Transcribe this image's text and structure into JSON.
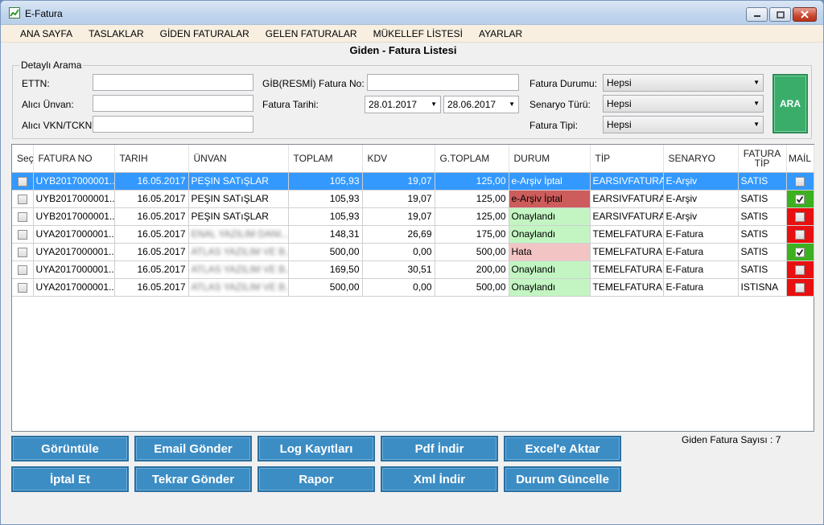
{
  "window": {
    "title": "E-Fatura"
  },
  "menu": [
    "ANA SAYFA",
    "TASLAKLAR",
    "GİDEN FATURALAR",
    "GELEN FATURALAR",
    "MÜKELLEF LİSTESİ",
    "AYARLAR"
  ],
  "page_title": "Giden - Fatura Listesi",
  "search": {
    "legend": "Detaylı Arama",
    "ettn_label": "ETTN:",
    "alici_unvan_label": "Alıcı Ünvan:",
    "alici_vkn_label": "Alıcı VKN/TCKN:",
    "gib_fatura_no_label": "GİB(RESMİ) Fatura No:",
    "fatura_tarihi_label": "Fatura Tarihi:",
    "date_from": "28.01.2017",
    "date_to": "28.06.2017",
    "fatura_durumu_label": "Fatura Durumu:",
    "fatura_durumu_value": "Hepsi",
    "senaryo_turu_label": "Senaryo Türü:",
    "senaryo_turu_value": "Hepsi",
    "fatura_tipi_label": "Fatura Tipi:",
    "fatura_tipi_value": "Hepsi",
    "ara_label": "ARA"
  },
  "table": {
    "headers": {
      "sec": "Seç",
      "fatura_no": "FATURA NO",
      "tarih": "TARIH",
      "unvan": "ÜNVAN",
      "toplam": "TOPLAM",
      "kdv": "KDV",
      "gtoplam": "G.TOPLAM",
      "durum": "DURUM",
      "tip": "TİP",
      "senaryo": "SENARYO",
      "fatura_tip": "FATURA TİP",
      "mail": "MAİL"
    },
    "rows": [
      {
        "fatura_no": "UYB2017000001...",
        "tarih": "16.05.2017",
        "unvan": "PEŞIN SATıŞLAR",
        "toplam": "105,93",
        "kdv": "19,07",
        "gtoplam": "125,00",
        "durum": "e-Arşiv İptal",
        "tip": "EARSIVFATURA",
        "senaryo": "E-Arşiv",
        "fatura_tip": "SATIS",
        "mail_checked": false,
        "durum_color": "#3399ff",
        "mail_color": "#3399ff"
      },
      {
        "fatura_no": "UYB2017000001...",
        "tarih": "16.05.2017",
        "unvan": "PEŞIN SATıŞLAR",
        "toplam": "105,93",
        "kdv": "19,07",
        "gtoplam": "125,00",
        "durum": "e-Arşiv İptal",
        "tip": "EARSIVFATURA",
        "senaryo": "E-Arşiv",
        "fatura_tip": "SATIS",
        "mail_checked": true,
        "durum_color": "#cd5c5c",
        "mail_color": "#3cb01e"
      },
      {
        "fatura_no": "UYB2017000001...",
        "tarih": "16.05.2017",
        "unvan": "PEŞIN SATıŞLAR",
        "toplam": "105,93",
        "kdv": "19,07",
        "gtoplam": "125,00",
        "durum": "Onaylandı",
        "tip": "EARSIVFATURA",
        "senaryo": "E-Arşiv",
        "fatura_tip": "SATIS",
        "mail_checked": false,
        "durum_color": "#c2f5c2",
        "mail_color": "#e81010"
      },
      {
        "fatura_no": "UYA2017000001...",
        "tarih": "16.05.2017",
        "unvan": "ENAL YAZILIM DANI...",
        "toplam": "148,31",
        "kdv": "26,69",
        "gtoplam": "175,00",
        "durum": "Onaylandı",
        "tip": "TEMELFATURA",
        "senaryo": "E-Fatura",
        "fatura_tip": "SATIS",
        "mail_checked": false,
        "durum_color": "#c2f5c2",
        "mail_color": "#e81010"
      },
      {
        "fatura_no": "UYA2017000001...",
        "tarih": "16.05.2017",
        "unvan": "ATLAS YAZILIM VE B...",
        "toplam": "500,00",
        "kdv": "0,00",
        "gtoplam": "500,00",
        "durum": "Hata",
        "tip": "TEMELFATURA",
        "senaryo": "E-Fatura",
        "fatura_tip": "SATIS",
        "mail_checked": true,
        "durum_color": "#f2c4c4",
        "mail_color": "#3cb01e"
      },
      {
        "fatura_no": "UYA2017000001...",
        "tarih": "16.05.2017",
        "unvan": "ATLAS YAZILIM VE B...",
        "toplam": "169,50",
        "kdv": "30,51",
        "gtoplam": "200,00",
        "durum": "Onaylandı",
        "tip": "TEMELFATURA",
        "senaryo": "E-Fatura",
        "fatura_tip": "SATIS",
        "mail_checked": false,
        "durum_color": "#c2f5c2",
        "mail_color": "#e81010"
      },
      {
        "fatura_no": "UYA2017000001...",
        "tarih": "16.05.2017",
        "unvan": "ATLAS YAZILIM VE B...",
        "toplam": "500,00",
        "kdv": "0,00",
        "gtoplam": "500,00",
        "durum": "Onaylandı",
        "tip": "TEMELFATURA",
        "senaryo": "E-Fatura",
        "fatura_tip": "ISTISNA",
        "mail_checked": false,
        "durum_color": "#c2f5c2",
        "mail_color": "#e81010"
      }
    ]
  },
  "buttons": {
    "goruntule": "Görüntüle",
    "email_gonder": "Email Gönder",
    "log_kayitlari": "Log Kayıtları",
    "pdf_indir": "Pdf İndir",
    "excel_aktar": "Excel'e Aktar",
    "iptal_et": "İptal Et",
    "tekrar_gonder": "Tekrar Gönder",
    "rapor": "Rapor",
    "xml_indir": "Xml İndir",
    "durum_guncelle": "Durum Güncelle"
  },
  "count_text": "Giden Fatura Sayısı : 7"
}
